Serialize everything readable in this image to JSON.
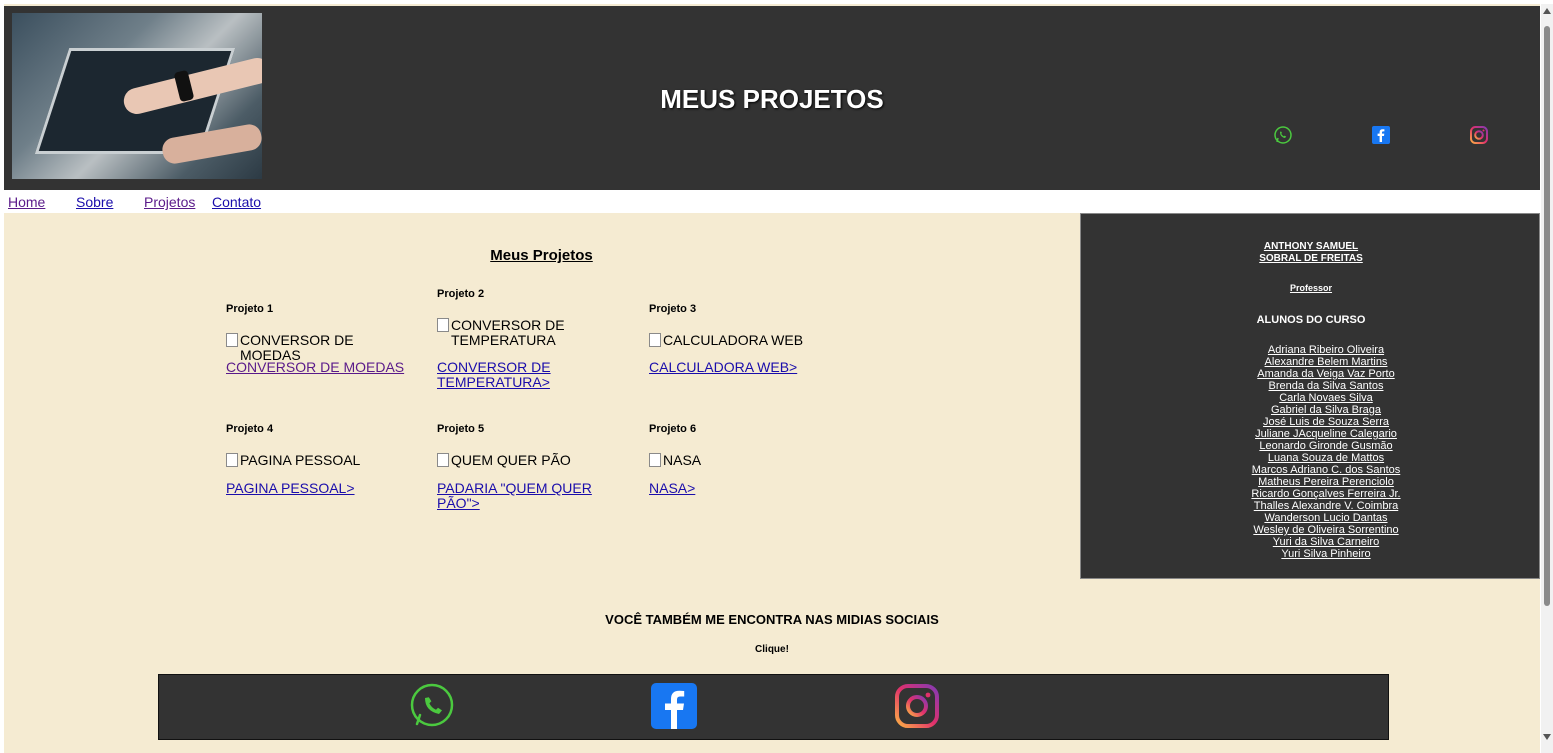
{
  "header": {
    "title": "MEUS PROJETOS",
    "social_icons": [
      "whatsapp-icon",
      "facebook-icon",
      "instagram-icon"
    ]
  },
  "nav": {
    "items": [
      {
        "label": "Home"
      },
      {
        "label": "Sobre"
      },
      {
        "label": "Projetos"
      },
      {
        "label": "Contato"
      }
    ]
  },
  "main": {
    "title": "Meus Projetos",
    "projects": [
      {
        "label": "Projeto 1",
        "image_alt": "CONVERSOR DE MOEDAS",
        "link": "CONVERSOR DE MOEDAS"
      },
      {
        "label": "Projeto 2",
        "image_alt": "CONVERSOR DE TEMPERATURA",
        "link": "CONVERSOR DE TEMPERATURA>"
      },
      {
        "label": "Projeto 3",
        "image_alt": "CALCULADORA WEB",
        "link": "CALCULADORA WEB>"
      },
      {
        "label": "Projeto 4",
        "image_alt": "PAGINA PESSOAL",
        "link": "PAGINA PESSOAL>"
      },
      {
        "label": "Projeto 5",
        "image_alt": "QUEM QUER PÃO",
        "link": "PADARIA \"QUEM QUER PÃO\">"
      },
      {
        "label": "Projeto 6",
        "image_alt": "NASA",
        "link": "NASA>"
      }
    ]
  },
  "aside": {
    "professor_name": "ANTHONY SAMUEL SOBRAL DE FREITAS",
    "professor_role": "Professor",
    "students_heading": "ALUNOS DO CURSO",
    "students": [
      "Adriana Ribeiro Oliveira",
      "Alexandre Belem Martins",
      "Amanda da Veiga Vaz Porto",
      "Brenda da Silva Santos",
      "Carla Novaes Silva",
      "Gabriel da Silva Braga",
      "José Luis de Souza Serra",
      "Juliane JAcqueline Calegario",
      "Leonardo Gironde Gusmão",
      "Luana Souza de Mattos",
      "Marcos Adriano C. dos Santos",
      "Matheus Pereira Perenciolo",
      "Ricardo Gonçalves Ferreira Jr.",
      "Thalles Alexandre V. Coimbra",
      "Wanderson Lucio Dantas",
      "Wesley de Oliveira Sorrentino",
      "Yuri da Silva Carneiro",
      "Yuri Silva Pinheiro"
    ]
  },
  "footer": {
    "follow_text": "VOCÊ TAMBÉM ME ENCONTRA NAS MIDIAS SOCIAIS",
    "click_text": "Clique!"
  },
  "colors": {
    "header_bg": "#333333",
    "page_bg": "#f5ebd2",
    "link": "#1a0dab",
    "visited_link": "#5a1a8a",
    "whatsapp": "#4bc93f",
    "facebook": "#1877f2",
    "instagram": "#e1306c"
  }
}
